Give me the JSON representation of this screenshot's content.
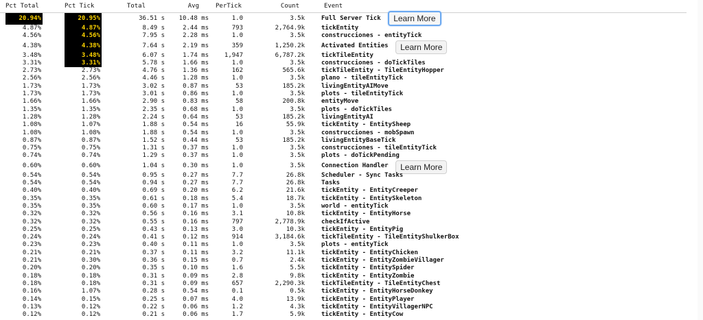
{
  "headers": [
    "Pct Total",
    "Pct Tick",
    "Total",
    "Avg",
    "PerTick",
    "Count",
    "Event"
  ],
  "learn_more_label": "Learn More",
  "colors": {
    "highlight_bg": "#000000",
    "highlight_fg": "#ffd400",
    "focus_ring": "#6aa8f0"
  },
  "rows": [
    {
      "pt": "20.94%",
      "ptk": "20.95%",
      "tot": "36.51 s",
      "avg": "10.48 ms",
      "per": "1.0",
      "cnt": "3.5k",
      "evt": "Full Server Tick",
      "hl_pt": true,
      "hl_ptk": true,
      "btn": true,
      "focus": true
    },
    {
      "pt": "4.87%",
      "ptk": "4.87%",
      "tot": "8.49 s",
      "avg": "2.44 ms",
      "per": "793",
      "cnt": "2,764.9k",
      "evt": "tickEntity",
      "hl_ptk": true
    },
    {
      "pt": "4.56%",
      "ptk": "4.56%",
      "tot": "7.95 s",
      "avg": "2.28 ms",
      "per": "1.0",
      "cnt": "3.5k",
      "evt": "construcciones - entityTick",
      "hl_ptk": true
    },
    {
      "pt": "4.38%",
      "ptk": "4.38%",
      "tot": "7.64 s",
      "avg": "2.19 ms",
      "per": "359",
      "cnt": "1,250.2k",
      "evt": "Activated Entities",
      "hl_ptk": true,
      "btn": true
    },
    {
      "pt": "3.48%",
      "ptk": "3.48%",
      "tot": "6.07 s",
      "avg": "1.74 ms",
      "per": "1,947",
      "cnt": "6,787.2k",
      "evt": "tickTileEntity",
      "hl_ptk": true
    },
    {
      "pt": "3.31%",
      "ptk": "3.31%",
      "tot": "5.78 s",
      "avg": "1.66 ms",
      "per": "1.0",
      "cnt": "3.5k",
      "evt": "construcciones - doTickTiles",
      "hl_ptk": true
    },
    {
      "pt": "2.73%",
      "ptk": "2.73%",
      "tot": "4.76 s",
      "avg": "1.36 ms",
      "per": "162",
      "cnt": "565.6k",
      "evt": "tickTileEntity - TileEntityHopper"
    },
    {
      "pt": "2.56%",
      "ptk": "2.56%",
      "tot": "4.46 s",
      "avg": "1.28 ms",
      "per": "1.0",
      "cnt": "3.5k",
      "evt": "plano - tileEntityTick"
    },
    {
      "pt": "1.73%",
      "ptk": "1.73%",
      "tot": "3.02 s",
      "avg": "0.87 ms",
      "per": "53",
      "cnt": "185.2k",
      "evt": "livingEntityAIMove"
    },
    {
      "pt": "1.73%",
      "ptk": "1.73%",
      "tot": "3.01 s",
      "avg": "0.86 ms",
      "per": "1.0",
      "cnt": "3.5k",
      "evt": "plots - tileEntityTick"
    },
    {
      "pt": "1.66%",
      "ptk": "1.66%",
      "tot": "2.90 s",
      "avg": "0.83 ms",
      "per": "58",
      "cnt": "200.8k",
      "evt": "entityMove"
    },
    {
      "pt": "1.35%",
      "ptk": "1.35%",
      "tot": "2.35 s",
      "avg": "0.68 ms",
      "per": "1.0",
      "cnt": "3.5k",
      "evt": "plots - doTickTiles"
    },
    {
      "pt": "1.28%",
      "ptk": "1.28%",
      "tot": "2.24 s",
      "avg": "0.64 ms",
      "per": "53",
      "cnt": "185.2k",
      "evt": "livingEntityAI"
    },
    {
      "pt": "1.08%",
      "ptk": "1.07%",
      "tot": "1.88 s",
      "avg": "0.54 ms",
      "per": "16",
      "cnt": "55.9k",
      "evt": "tickEntity - EntitySheep"
    },
    {
      "pt": "1.08%",
      "ptk": "1.08%",
      "tot": "1.88 s",
      "avg": "0.54 ms",
      "per": "1.0",
      "cnt": "3.5k",
      "evt": "construcciones - mobSpawn"
    },
    {
      "pt": "0.87%",
      "ptk": "0.87%",
      "tot": "1.52 s",
      "avg": "0.44 ms",
      "per": "53",
      "cnt": "185.2k",
      "evt": "livingEntityBaseTick"
    },
    {
      "pt": "0.75%",
      "ptk": "0.75%",
      "tot": "1.31 s",
      "avg": "0.37 ms",
      "per": "1.0",
      "cnt": "3.5k",
      "evt": "construcciones - tileEntityTick"
    },
    {
      "pt": "0.74%",
      "ptk": "0.74%",
      "tot": "1.29 s",
      "avg": "0.37 ms",
      "per": "1.0",
      "cnt": "3.5k",
      "evt": "plots - doTickPending"
    },
    {
      "pt": "0.60%",
      "ptk": "0.60%",
      "tot": "1.04 s",
      "avg": "0.30 ms",
      "per": "1.0",
      "cnt": "3.5k",
      "evt": "Connection Handler",
      "btn": true
    },
    {
      "pt": "0.54%",
      "ptk": "0.54%",
      "tot": "0.95 s",
      "avg": "0.27 ms",
      "per": "7.7",
      "cnt": "26.8k",
      "evt": "Scheduler - Sync Tasks"
    },
    {
      "pt": "0.54%",
      "ptk": "0.54%",
      "tot": "0.94 s",
      "avg": "0.27 ms",
      "per": "7.7",
      "cnt": "26.8k",
      "evt": "Tasks"
    },
    {
      "pt": "0.40%",
      "ptk": "0.40%",
      "tot": "0.69 s",
      "avg": "0.20 ms",
      "per": "6.2",
      "cnt": "21.6k",
      "evt": "tickEntity - EntityCreeper"
    },
    {
      "pt": "0.35%",
      "ptk": "0.35%",
      "tot": "0.61 s",
      "avg": "0.18 ms",
      "per": "5.4",
      "cnt": "18.7k",
      "evt": "tickEntity - EntitySkeleton"
    },
    {
      "pt": "0.35%",
      "ptk": "0.35%",
      "tot": "0.60 s",
      "avg": "0.17 ms",
      "per": "1.0",
      "cnt": "3.5k",
      "evt": "world - entityTick"
    },
    {
      "pt": "0.32%",
      "ptk": "0.32%",
      "tot": "0.56 s",
      "avg": "0.16 ms",
      "per": "3.1",
      "cnt": "10.8k",
      "evt": "tickEntity - EntityHorse"
    },
    {
      "pt": "0.32%",
      "ptk": "0.32%",
      "tot": "0.55 s",
      "avg": "0.16 ms",
      "per": "797",
      "cnt": "2,778.9k",
      "evt": "checkIfActive"
    },
    {
      "pt": "0.25%",
      "ptk": "0.25%",
      "tot": "0.43 s",
      "avg": "0.13 ms",
      "per": "3.0",
      "cnt": "10.3k",
      "evt": "tickEntity - EntityPig"
    },
    {
      "pt": "0.24%",
      "ptk": "0.24%",
      "tot": "0.41 s",
      "avg": "0.12 ms",
      "per": "914",
      "cnt": "3,184.6k",
      "evt": "tickTileEntity - TileEntityShulkerBox"
    },
    {
      "pt": "0.23%",
      "ptk": "0.23%",
      "tot": "0.40 s",
      "avg": "0.11 ms",
      "per": "1.0",
      "cnt": "3.5k",
      "evt": "plots - entityTick"
    },
    {
      "pt": "0.21%",
      "ptk": "0.21%",
      "tot": "0.37 s",
      "avg": "0.11 ms",
      "per": "3.2",
      "cnt": "11.1k",
      "evt": "tickEntity - EntityChicken"
    },
    {
      "pt": "0.21%",
      "ptk": "0.30%",
      "tot": "0.36 s",
      "avg": "0.15 ms",
      "per": "0.7",
      "cnt": "2.4k",
      "evt": "tickEntity - EntityZombieVillager"
    },
    {
      "pt": "0.20%",
      "ptk": "0.20%",
      "tot": "0.35 s",
      "avg": "0.10 ms",
      "per": "1.6",
      "cnt": "5.5k",
      "evt": "tickEntity - EntitySpider"
    },
    {
      "pt": "0.18%",
      "ptk": "0.18%",
      "tot": "0.31 s",
      "avg": "0.09 ms",
      "per": "2.8",
      "cnt": "9.8k",
      "evt": "tickEntity - EntityZombie"
    },
    {
      "pt": "0.18%",
      "ptk": "0.18%",
      "tot": "0.31 s",
      "avg": "0.09 ms",
      "per": "657",
      "cnt": "2,290.3k",
      "evt": "tickTileEntity - TileEntityChest"
    },
    {
      "pt": "0.16%",
      "ptk": "1.07%",
      "tot": "0.28 s",
      "avg": "0.54 ms",
      "per": "0.1",
      "cnt": "0.5k",
      "evt": "tickEntity - EntityHorseDonkey"
    },
    {
      "pt": "0.14%",
      "ptk": "0.15%",
      "tot": "0.25 s",
      "avg": "0.07 ms",
      "per": "4.0",
      "cnt": "13.9k",
      "evt": "tickEntity - EntityPlayer"
    },
    {
      "pt": "0.13%",
      "ptk": "0.12%",
      "tot": "0.22 s",
      "avg": "0.06 ms",
      "per": "1.2",
      "cnt": "4.3k",
      "evt": "tickEntity - EntityVillagerNPC"
    },
    {
      "pt": "0.12%",
      "ptk": "0.12%",
      "tot": "0.21 s",
      "avg": "0.06 ms",
      "per": "1.7",
      "cnt": "5.9k",
      "evt": "tickEntity - EntityCow"
    }
  ]
}
